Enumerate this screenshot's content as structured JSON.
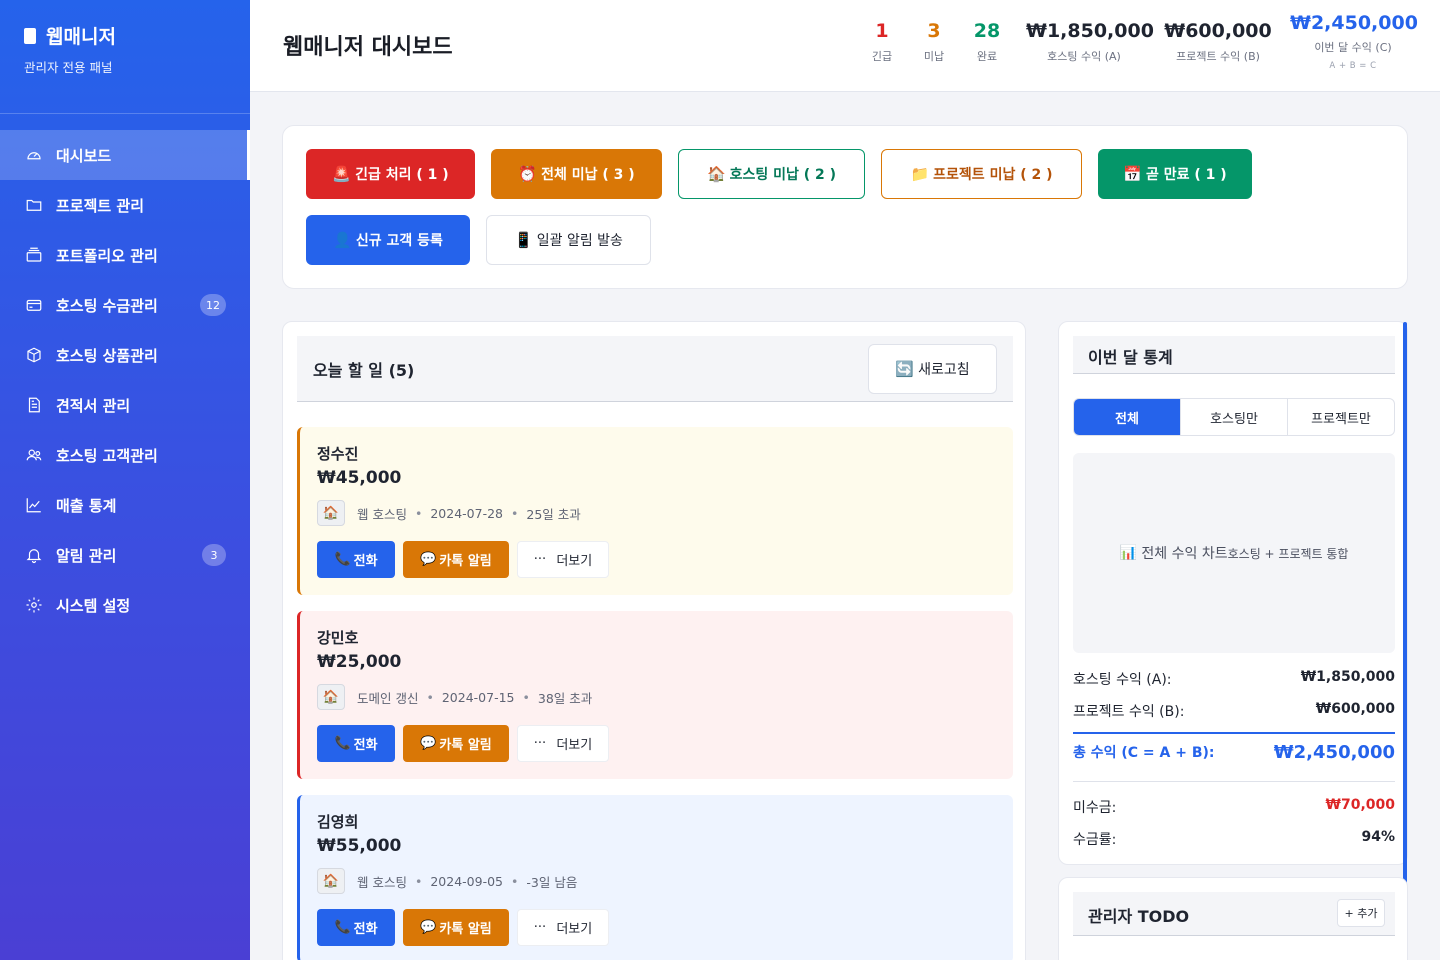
{
  "app": {
    "title": "웹매니저",
    "subtitle": "관리자 전용 패널"
  },
  "sidebar": {
    "items": [
      {
        "label": "대시보드",
        "icon": "gauge-icon",
        "active": true
      },
      {
        "label": "프로젝트 관리",
        "icon": "folder-icon"
      },
      {
        "label": "포트폴리오 관리",
        "icon": "stack-icon"
      },
      {
        "label": "호스팅 수금관리",
        "icon": "credit-card-icon",
        "badge": "12"
      },
      {
        "label": "호스팅 상품관리",
        "icon": "box-icon"
      },
      {
        "label": "견적서 관리",
        "icon": "document-icon"
      },
      {
        "label": "호스팅 고객관리",
        "icon": "users-icon"
      },
      {
        "label": "매출 통계",
        "icon": "line-chart-icon"
      },
      {
        "label": "알림 관리",
        "icon": "bell-icon",
        "badge": "3"
      },
      {
        "label": "시스템 설정",
        "icon": "gear-icon"
      }
    ]
  },
  "header": {
    "title": "웹매니저 대시보드",
    "stats": [
      {
        "value": "1",
        "label": "긴급",
        "color": "#dc2626"
      },
      {
        "value": "3",
        "label": "미납",
        "color": "#d97706"
      },
      {
        "value": "28",
        "label": "완료",
        "color": "#059669"
      },
      {
        "value": "₩1,850,000",
        "label": "호스팅 수익 (A)",
        "color": "#1f2430"
      },
      {
        "value": "₩600,000",
        "label": "프로젝트 수익 (B)",
        "color": "#1f2430"
      },
      {
        "value": "₩2,450,000",
        "label": "이번 달 수익 (C)",
        "sub": "A + B = C",
        "color": "#2563eb"
      }
    ]
  },
  "actions": {
    "urgent": {
      "icon": "🚨",
      "label": "긴급 처리 ( 1 )"
    },
    "unpaid_all": {
      "icon": "⏰",
      "label": "전체 미납 ( 3 )"
    },
    "unpaid_hosting": {
      "icon": "🏠",
      "label": "호스팅 미납 ( 2 )"
    },
    "unpaid_project": {
      "icon": "📁",
      "label": "프로젝트 미납 ( 2 )"
    },
    "expiring": {
      "icon": "📅",
      "label": "곧 만료 ( 1 )"
    },
    "new_customer": {
      "icon": "👤",
      "label": "신규 고객 등록"
    },
    "bulk_notify": {
      "icon": "📱",
      "label": "일괄 알림 발송"
    }
  },
  "today": {
    "title": "오늘 할 일 (5)",
    "refresh_icon": "🔄",
    "refresh_label": "새로고침",
    "tasks": [
      {
        "name": "정수진",
        "amount": "₩45,000",
        "icon": "🏠",
        "service": "웹 호스팅",
        "date": "2024-07-28",
        "status": "25일 초과"
      },
      {
        "name": "강민호",
        "amount": "₩25,000",
        "icon": "🏠",
        "service": "도메인 갱신",
        "date": "2024-07-15",
        "status": "38일 초과"
      },
      {
        "name": "김영희",
        "amount": "₩55,000",
        "icon": "🏠",
        "service": "웹 호스팅",
        "date": "2024-09-05",
        "status": "-3일 남음"
      }
    ],
    "buttons": {
      "call_icon": "📞",
      "call": "전화",
      "kakao_icon": "💬",
      "kakao": "카톡 알림",
      "more_icon": "···",
      "more": "더보기"
    },
    "separator": "•"
  },
  "stats": {
    "title": "이번 달 통계",
    "tabs": [
      "전체",
      "호스팅만",
      "프로젝트만"
    ],
    "chart_icon": "📊",
    "chart_label": "전체 수익 차트",
    "chart_sub": "호스팅 + 프로젝트 통합",
    "hosting_label": "호스팅 수익 (A):",
    "hosting_value": "₩1,850,000",
    "project_label": "프로젝트 수익 (B):",
    "project_value": "₩600,000",
    "total_label": "총 수익 (C = A + B):",
    "total_value": "₩2,450,000",
    "unpaid_label": "미수금:",
    "unpaid_value": "₩70,000",
    "rate_label": "수금률:",
    "rate_value": "94%"
  },
  "todo": {
    "title": "관리자 TODO",
    "add_label": "+ 추가"
  }
}
